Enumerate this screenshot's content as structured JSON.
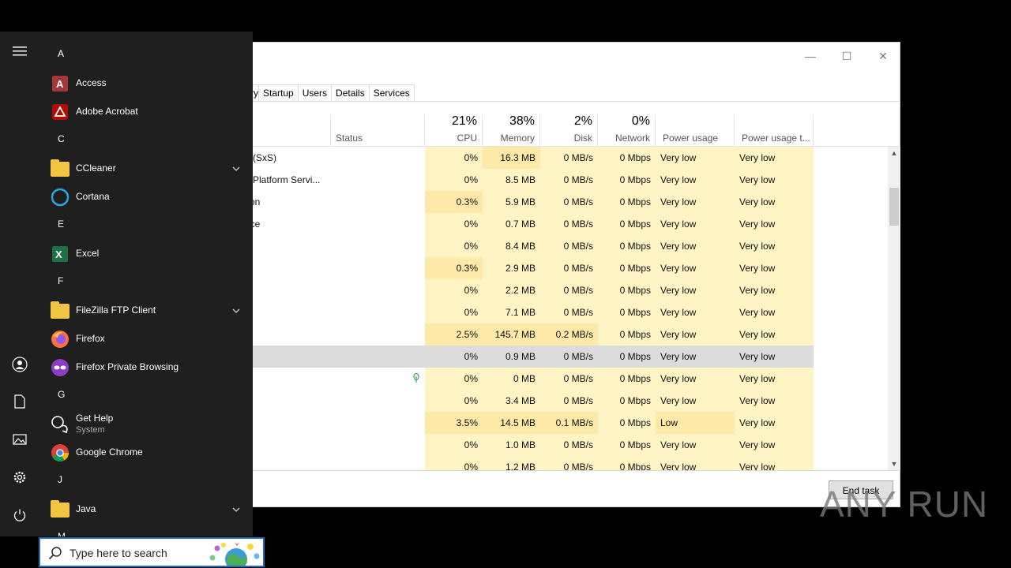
{
  "task_manager": {
    "tabs": [
      "ry",
      "Startup",
      "Users",
      "Details",
      "Services"
    ],
    "columns": {
      "status": {
        "label": "Status"
      },
      "cpu": {
        "pct": "21%",
        "label": "CPU"
      },
      "memory": {
        "pct": "38%",
        "label": "Memory"
      },
      "disk": {
        "pct": "2%",
        "label": "Disk"
      },
      "network": {
        "pct": "0%",
        "label": "Network"
      },
      "power": {
        "label": "Power usage"
      },
      "power_trend": {
        "label": "Power usage t..."
      }
    },
    "rows": [
      {
        "name": "n (SxS)",
        "cpu": "0%",
        "mem": "16.3 MB",
        "disk": "0 MB/s",
        "net": "0 Mbps",
        "power": "Very low",
        "trend": "Very low"
      },
      {
        "name": "n Platform Servi...",
        "cpu": "0%",
        "mem": "8.5 MB",
        "disk": "0 MB/s",
        "net": "0 Mbps",
        "power": "Very low",
        "trend": "Very low"
      },
      {
        "name": "tion",
        "cpu": "0.3%",
        "mem": "5.9 MB",
        "disk": "0 MB/s",
        "net": "0 Mbps",
        "power": "Very low",
        "trend": "Very low"
      },
      {
        "name": "rice",
        "cpu": "0%",
        "mem": "0.7 MB",
        "disk": "0 MB/s",
        "net": "0 Mbps",
        "power": "Very low",
        "trend": "Very low"
      },
      {
        "name": "",
        "cpu": "0%",
        "mem": "8.4 MB",
        "disk": "0 MB/s",
        "net": "0 Mbps",
        "power": "Very low",
        "trend": "Very low"
      },
      {
        "name": "",
        "cpu": "0.3%",
        "mem": "2.9 MB",
        "disk": "0 MB/s",
        "net": "0 Mbps",
        "power": "Very low",
        "trend": "Very low"
      },
      {
        "name": "",
        "cpu": "0%",
        "mem": "2.2 MB",
        "disk": "0 MB/s",
        "net": "0 Mbps",
        "power": "Very low",
        "trend": "Very low"
      },
      {
        "name": "",
        "cpu": "0%",
        "mem": "7.1 MB",
        "disk": "0 MB/s",
        "net": "0 Mbps",
        "power": "Very low",
        "trend": "Very low"
      },
      {
        "name": "",
        "cpu": "2.5%",
        "mem": "145.7 MB",
        "disk": "0.2 MB/s",
        "net": "0 Mbps",
        "power": "Very low",
        "trend": "Very low"
      },
      {
        "name": "",
        "cpu": "0%",
        "mem": "0.9 MB",
        "disk": "0 MB/s",
        "net": "0 Mbps",
        "power": "Very low",
        "trend": "Very low"
      },
      {
        "name": "",
        "cpu": "0%",
        "mem": "0 MB",
        "disk": "0 MB/s",
        "net": "0 Mbps",
        "power": "Very low",
        "trend": "Very low"
      },
      {
        "name": "",
        "cpu": "0%",
        "mem": "3.4 MB",
        "disk": "0 MB/s",
        "net": "0 Mbps",
        "power": "Very low",
        "trend": "Very low"
      },
      {
        "name": "",
        "cpu": "3.5%",
        "mem": "14.5 MB",
        "disk": "0.1 MB/s",
        "net": "0 Mbps",
        "power": "Low",
        "trend": "Very low"
      },
      {
        "name": "",
        "cpu": "0%",
        "mem": "1.0 MB",
        "disk": "0 MB/s",
        "net": "0 Mbps",
        "power": "Very low",
        "trend": "Very low"
      },
      {
        "name": "",
        "cpu": "0%",
        "mem": "1.2 MB",
        "disk": "0 MB/s",
        "net": "0 Mbps",
        "power": "Very low",
        "trend": "Very low"
      }
    ],
    "selected_row": 9,
    "end_task_label": "End task",
    "window_controls": {
      "minimize": "—",
      "maximize": "☐",
      "close": "✕"
    }
  },
  "start_menu": {
    "groups": [
      {
        "letter": "A",
        "apps": [
          {
            "label": "Access",
            "icon": "access-icon"
          },
          {
            "label": "Adobe Acrobat",
            "icon": "acrobat-icon"
          }
        ]
      },
      {
        "letter": "C",
        "apps": [
          {
            "label": "CCleaner",
            "icon": "folder-icon",
            "expandable": true
          },
          {
            "label": "Cortana",
            "icon": "cortana-icon"
          }
        ]
      },
      {
        "letter": "E",
        "apps": [
          {
            "label": "Excel",
            "icon": "excel-icon"
          }
        ]
      },
      {
        "letter": "F",
        "apps": [
          {
            "label": "FileZilla FTP Client",
            "icon": "folder-icon",
            "expandable": true
          },
          {
            "label": "Firefox",
            "icon": "firefox-icon"
          },
          {
            "label": "Firefox Private Browsing",
            "icon": "firefox-private-icon"
          }
        ]
      },
      {
        "letter": "G",
        "apps": [
          {
            "label": "Get Help",
            "sub": "System",
            "icon": "get-help-icon"
          },
          {
            "label": "Google Chrome",
            "icon": "chrome-icon"
          }
        ]
      },
      {
        "letter": "J",
        "apps": [
          {
            "label": "Java",
            "icon": "folder-icon",
            "expandable": true
          }
        ]
      },
      {
        "letter": "M",
        "apps": []
      }
    ]
  },
  "taskbar": {
    "search_placeholder": "Type here to search"
  },
  "watermark": "ANY RUN",
  "colors": {
    "cell_highlight": "#fff4c4",
    "cell_highlight_strong": "#ffe9a8",
    "selected_row": "#dcdcdc",
    "start_bg": "#1f1f1f",
    "search_border": "#1b6ec2"
  }
}
